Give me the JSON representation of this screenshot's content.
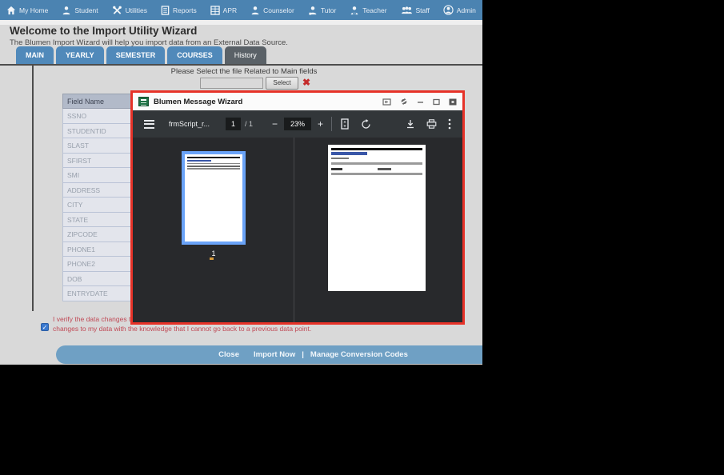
{
  "nav": {
    "items": [
      {
        "label": "My Home",
        "icon": "home-icon"
      },
      {
        "label": "Student",
        "icon": "student-icon"
      },
      {
        "label": "Utilities",
        "icon": "utilities-icon"
      },
      {
        "label": "Reports",
        "icon": "reports-icon"
      },
      {
        "label": "APR",
        "icon": "apr-icon"
      },
      {
        "label": "Counselor",
        "icon": "counselor-icon"
      },
      {
        "label": "Tutor",
        "icon": "tutor-icon"
      },
      {
        "label": "Teacher",
        "icon": "teacher-icon"
      },
      {
        "label": "Staff",
        "icon": "staff-icon"
      },
      {
        "label": "Admin",
        "icon": "admin-icon"
      }
    ]
  },
  "header": {
    "title": "Welcome to the Import Utility Wizard",
    "subtitle": "The Blumen Import Wizard will help you import data from an External Data Source."
  },
  "tabs": [
    {
      "label": "MAIN",
      "active": false
    },
    {
      "label": "YEARLY",
      "active": false
    },
    {
      "label": "SEMESTER",
      "active": false
    },
    {
      "label": "COURSES",
      "active": false
    },
    {
      "label": "History",
      "active": true
    }
  ],
  "file_select": {
    "prompt": "Please Select the file Related to Main fields",
    "input_value": "",
    "select_button": "Select",
    "clear_glyph": "✖"
  },
  "field_table": {
    "header": "Field Name",
    "rows": [
      "SSNO",
      "STUDENTID",
      "SLAST",
      "SFIRST",
      "SMI",
      "ADDRESS",
      "CITY",
      "STATE",
      "ZIPCODE",
      "PHONE1",
      "PHONE2",
      "DOB",
      "ENTRYDATE"
    ]
  },
  "verify": {
    "checked": true,
    "check_glyph": "✓",
    "line1": "I verify the data changes th",
    "line2": "changes to my data with the knowledge that I cannot go back to a previous data point."
  },
  "footer": {
    "close": "Close",
    "import_now": "Import Now",
    "divider": "|",
    "manage": "Manage Conversion Codes"
  },
  "modal": {
    "title": "Blumen Message Wizard",
    "pdf_toolbar": {
      "filename": "frmScript_r...",
      "page_current": "1",
      "page_total": "/ 1",
      "zoom_out_glyph": "−",
      "zoom_level": "23%",
      "zoom_in_glyph": "+"
    },
    "sidebar": {
      "thumb_page_number": "1"
    }
  },
  "colors": {
    "nav_blue": "#4b83b1",
    "tab_blue": "#5089ba",
    "tab_active_gray": "#5a6167",
    "footer_blue": "#6fa0c4",
    "modal_border_red": "#e63228",
    "pdf_toolbar_dark": "#323639",
    "pdf_bg_dark": "#28292c",
    "thumb_selected_blue": "#6aa3f8",
    "verify_text_red": "#c04a56",
    "checkbox_blue": "#3a79cf"
  }
}
